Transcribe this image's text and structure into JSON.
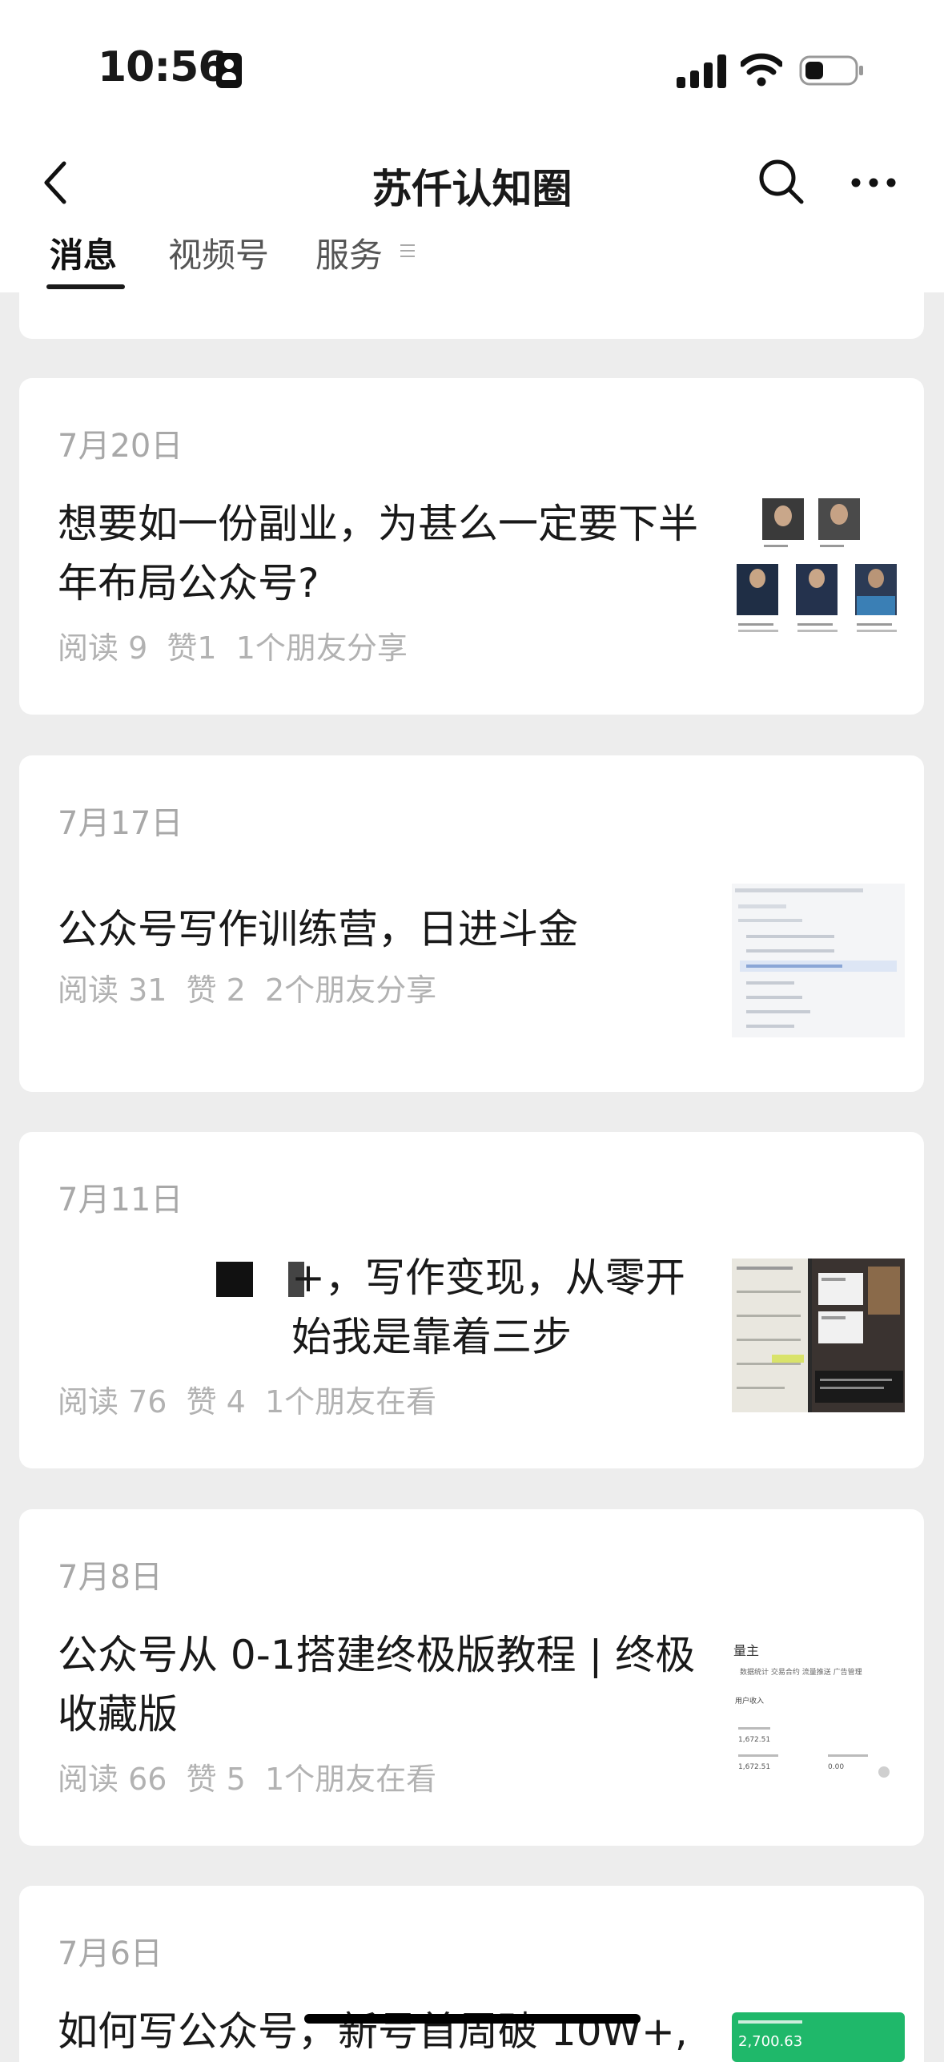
{
  "status_bar": {
    "time": "10:56"
  },
  "nav": {
    "title": "苏仟认知圈"
  },
  "tabs": [
    {
      "label": "消息",
      "active": true
    },
    {
      "label": "视频号",
      "active": false
    },
    {
      "label": "服务",
      "active": false
    }
  ],
  "articles": [
    {
      "date": "7月20日",
      "title": "想要如一份副业，为甚么一定要下半年布局公众号?",
      "stats": "阅读 9  赞1  1个朋友分享",
      "thumbnail": "people-portraits"
    },
    {
      "date": "7月17日",
      "title": "公众号写作训练营，日进斗金",
      "stats": "阅读 31  赞 2  2个朋友分享",
      "thumbnail": "document-list-screenshot"
    },
    {
      "date": "7月11日",
      "title": "+，写作变现，从零开始我是靠着三步",
      "stats": "阅读 76  赞 4  1个朋友在看",
      "thumbnail": "dashboard-collage"
    },
    {
      "date": "7月8日",
      "title": "公众号从 0-1搭建终极版教程 | 终极收藏版",
      "stats": "阅读 66  赞 5  1个朋友在看",
      "thumbnail": "analytics-screenshot"
    },
    {
      "date": "7月6日",
      "title": "如何写公众号，新号首周破 10W+,",
      "stats": "",
      "thumbnail": "green-stats-card"
    }
  ],
  "thumb_texts": {
    "analytics_header": "量主",
    "analytics_tabs": "数据统计   交易合约   流量推送   广告管理",
    "analytics_sub": "用户收入",
    "analytics_v1": "1,672.51",
    "analytics_v2": "1,672.51",
    "analytics_v3": "0.00",
    "green_value": "2,700.63"
  },
  "colors": {
    "background": "#ededed",
    "card": "#ffffff",
    "date_text": "#a8a8a8",
    "stats_text": "#b2b2b2",
    "title_text": "#191919"
  }
}
